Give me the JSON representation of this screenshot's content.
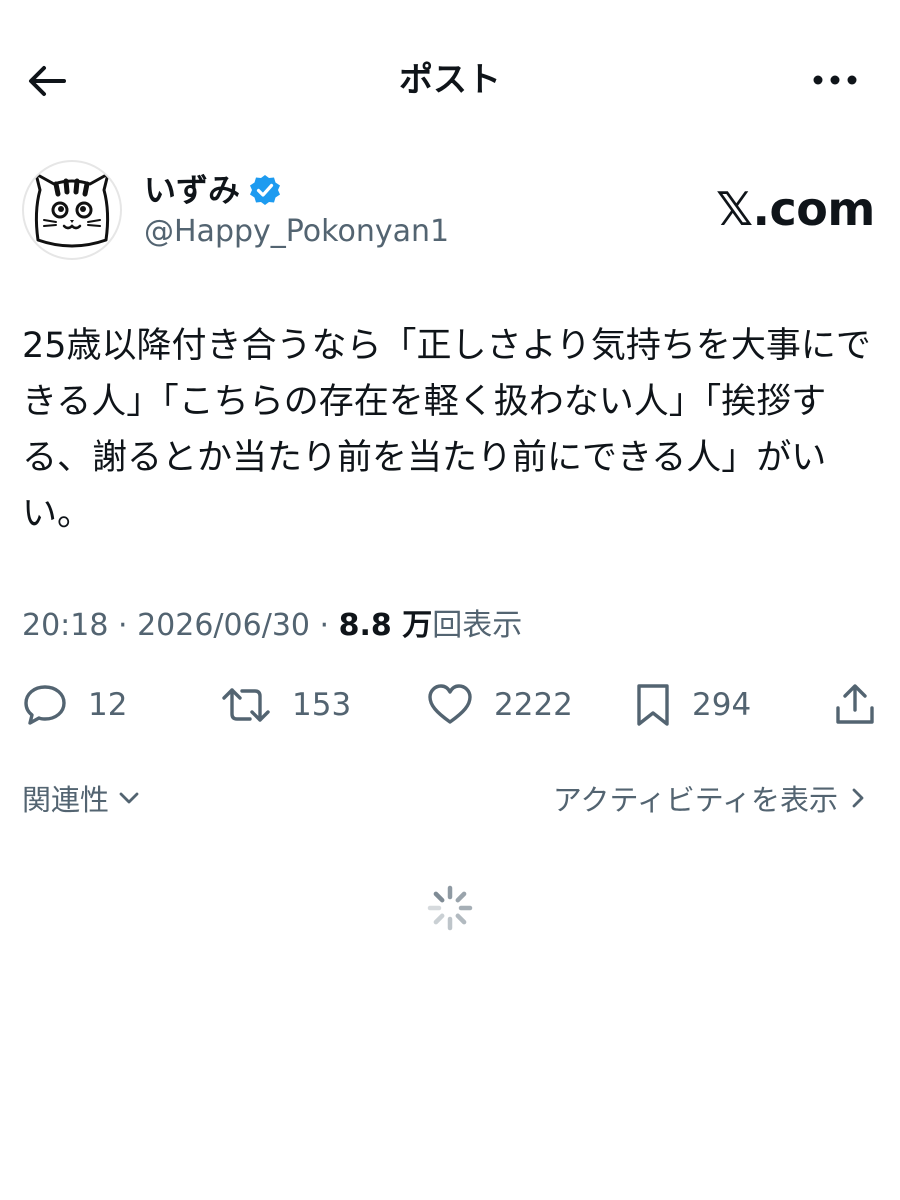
{
  "header": {
    "title": "ポスト",
    "back_icon": "arrow-left-icon",
    "more_icon": "more-dots-icon"
  },
  "author": {
    "display_name": "いずみ",
    "handle": "@Happy_Pokonyan1",
    "verified_icon": "verified-badge-icon",
    "verified_color": "#1d9bf0"
  },
  "source_label": "𝕏.com",
  "post": {
    "text": "25歳以降付き合うなら「正しさより気持ちを大事にできる人」「こちらの存在を軽く扱わない人」「挨拶する、謝るとか当たり前を当たり前にできる人」がいい。"
  },
  "meta": {
    "time": "20:18",
    "separator": " · ",
    "date": "2026/06/30",
    "views_count": "8.8 万",
    "views_label": "回表示"
  },
  "actions": {
    "replies": "12",
    "reposts": "153",
    "likes": "2222",
    "bookmarks": "294"
  },
  "footer": {
    "relevance_label": "関連性",
    "activity_label": "アクティビティを表示"
  },
  "colors": {
    "text": "#0f1419",
    "secondary": "#536471",
    "accent": "#1d9bf0"
  }
}
